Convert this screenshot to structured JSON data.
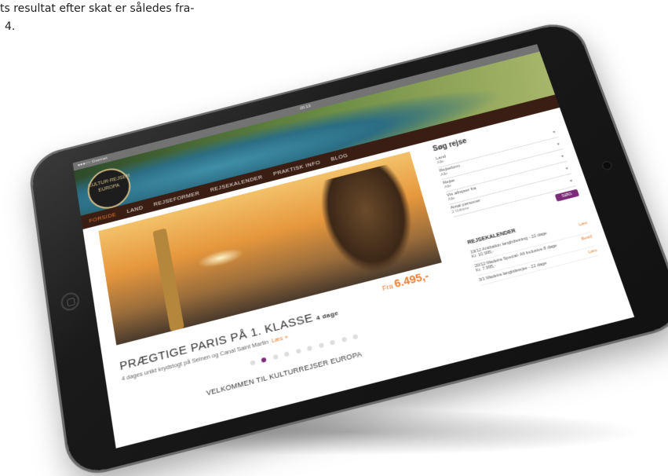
{
  "document": {
    "lines": [
      "ts resultat efter skat er således fra-",
      "4."
    ]
  },
  "statusbar": {
    "carrier": "●●●○○ Gvernet",
    "time": "20:13"
  },
  "logo": {
    "line1": "KULTUR·REJSER",
    "line2": "EUROPA"
  },
  "nav": {
    "items": [
      "FORSIDE",
      "LAND",
      "REJSEFORMER",
      "REJSEKALENDER",
      "PRAKTISK INFO",
      "BLOG"
    ],
    "active_index": 0
  },
  "hero": {
    "price_prefix": "Fra",
    "price": "6.495,-",
    "headline": "PRÆGTIGE PARIS PÅ 1. KLASSE",
    "days": "4 dage",
    "subtitle": "4 dages unikt krydstogt på Seinen og Canal Saint Martin",
    "read_more": "Læs »",
    "dots_total": 10,
    "dots_active": 1
  },
  "search": {
    "title": "Søg rejse",
    "fields": [
      {
        "label": "Land",
        "value": "Alle"
      },
      {
        "label": "Rejseform",
        "value": "Alle"
      },
      {
        "label": "Rejse",
        "value": "Alle"
      },
      {
        "label": "Vis afrejser fra",
        "value": "Alle"
      },
      {
        "label": "Antal personer",
        "value": "2 Voksne"
      }
    ],
    "button": "SØG"
  },
  "calendar": {
    "title": "REJSEKALENDER",
    "rows": [
      {
        "text": "19/12 Antibalion langbdsoning - 22 dage",
        "price": "Kr. 10.995,-",
        "action": "Læs"
      },
      {
        "text": "20/12 Madeira Special- All Inclusive 8 dage",
        "price": "Kr. 7.995,-",
        "action": "Bestil"
      },
      {
        "text": "3/1 Madeira langtidsrejse - 22 dage",
        "price": "",
        "action": "Læs"
      }
    ]
  },
  "welcome": "VELKOMMEN TIL KULTURREJSER EUROPA",
  "colors": {
    "accent": "#e97d2e",
    "brand_purple": "#7b2b78",
    "nav_bg": "#3a1e14"
  }
}
